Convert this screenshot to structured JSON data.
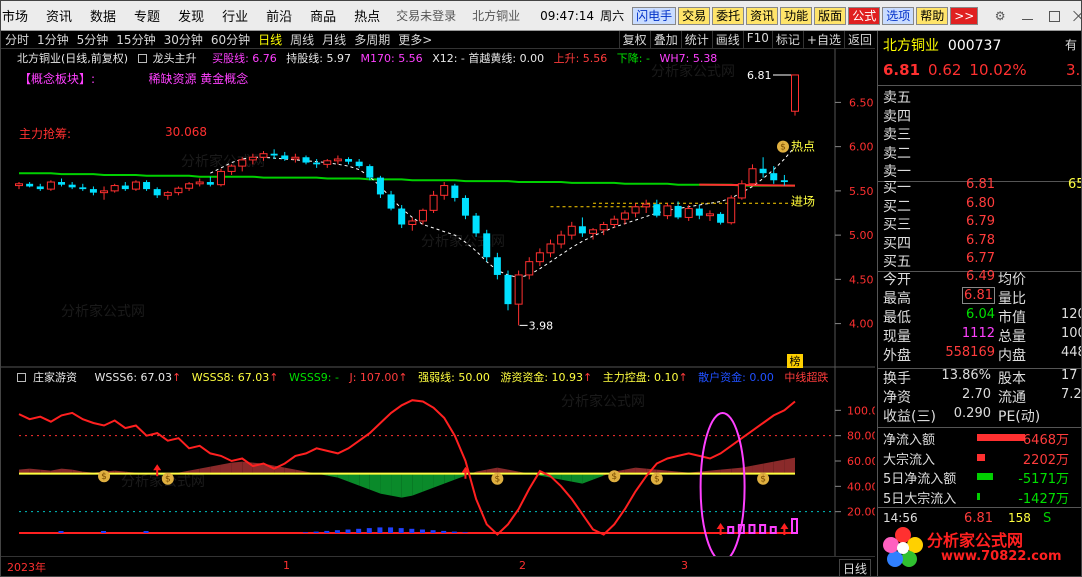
{
  "menu": {
    "items": [
      "市场",
      "资讯",
      "数据",
      "专题",
      "发现",
      "行业",
      "前沿",
      "商品",
      "热点"
    ],
    "login_status": "交易未登录",
    "stock_short": "北方铜业",
    "clock": "09:47:14",
    "weekday": "周六",
    "tools": [
      {
        "label": "闪电手",
        "style": "blue"
      },
      {
        "label": "交易",
        "style": "yellow"
      },
      {
        "label": "委托",
        "style": "yellow"
      },
      {
        "label": "资讯",
        "style": "yellow"
      },
      {
        "label": "功能",
        "style": "yellow"
      },
      {
        "label": "版面",
        "style": "yellow"
      },
      {
        "label": "公式",
        "style": "red"
      },
      {
        "label": "选项",
        "style": "blue"
      },
      {
        "label": "帮助",
        "style": "yellow"
      }
    ],
    "next_label": ">>"
  },
  "periods": {
    "items": [
      "分时",
      "1分钟",
      "5分钟",
      "15分钟",
      "30分钟",
      "60分钟",
      "日线",
      "周线",
      "月线",
      "多周期",
      "更多"
    ],
    "active": "日线",
    "more_arrow": ">"
  },
  "right_tools": [
    "复权",
    "叠加",
    "统计",
    "画线",
    "F10",
    "标记",
    "+自选",
    "返回"
  ],
  "main_header": {
    "stock": "北方铜业(日线,前复权)",
    "strategy": "龙头主升",
    "buy_line": "买股线: 6.76",
    "hold_line": "持股线: 5.97",
    "m170": "M170: 5.56",
    "x12": "X12: - 首越黄线: 0.00",
    "up": "上升: 5.56",
    "down": "下降: -",
    "wh7": "WH7: 5.38"
  },
  "concept": {
    "label": "【概念板块】:",
    "value": "稀缺资源 黄金概念"
  },
  "main_force": {
    "label": "主力抢筹:",
    "value": "30.068"
  },
  "annotations": {
    "high": "6.81",
    "low": "3.98",
    "hot": "热点",
    "entry": "进场",
    "rank": "榜"
  },
  "icons": {
    "money_bag": "money-bag-icon",
    "up_arrow": "up-arrow-icon"
  },
  "colors": {
    "up": "#ff3030",
    "down": "#00e0ff",
    "ma": "#00d000",
    "bg": "#000000"
  },
  "sub_header": {
    "name": "庄家游资",
    "wsss6": "WSSS6: 67.03",
    "wsss8": "WSSS8: 67.03",
    "wsss9": "WSSS9: -",
    "j": "J: 107.00",
    "strength": "强弱线: 50.00",
    "hot_money": "游资资金: 10.93",
    "control": "主力控盘: 0.10",
    "retail": "散户资金: 0.00",
    "super": "中线超跌"
  },
  "date_axis": {
    "labels": [
      "2023年",
      "1",
      "2",
      "3"
    ],
    "period_btn": "日线"
  },
  "chart_data": [
    {
      "type": "candlestick",
      "title": "北方铜业(日线,前复权)",
      "ylim": [
        3.6,
        6.9
      ],
      "yticks": [
        4.0,
        4.5,
        5.0,
        5.5,
        6.0,
        6.5
      ],
      "ohlc": [
        [
          5.56,
          5.6,
          5.52,
          5.58
        ],
        [
          5.58,
          5.6,
          5.54,
          5.55
        ],
        [
          5.55,
          5.58,
          5.5,
          5.52
        ],
        [
          5.52,
          5.62,
          5.5,
          5.6
        ],
        [
          5.6,
          5.64,
          5.55,
          5.57
        ],
        [
          5.57,
          5.6,
          5.52,
          5.54
        ],
        [
          5.54,
          5.58,
          5.5,
          5.52
        ],
        [
          5.52,
          5.55,
          5.45,
          5.48
        ],
        [
          5.48,
          5.55,
          5.4,
          5.5
        ],
        [
          5.5,
          5.58,
          5.48,
          5.56
        ],
        [
          5.56,
          5.6,
          5.5,
          5.52
        ],
        [
          5.52,
          5.62,
          5.5,
          5.6
        ],
        [
          5.6,
          5.62,
          5.5,
          5.52
        ],
        [
          5.52,
          5.54,
          5.42,
          5.45
        ],
        [
          5.45,
          5.5,
          5.4,
          5.48
        ],
        [
          5.48,
          5.55,
          5.45,
          5.53
        ],
        [
          5.53,
          5.6,
          5.5,
          5.58
        ],
        [
          5.58,
          5.64,
          5.55,
          5.6
        ],
        [
          5.6,
          5.66,
          5.55,
          5.57
        ],
        [
          5.57,
          5.75,
          5.55,
          5.72
        ],
        [
          5.72,
          5.8,
          5.68,
          5.78
        ],
        [
          5.78,
          5.88,
          5.72,
          5.85
        ],
        [
          5.85,
          5.92,
          5.8,
          5.88
        ],
        [
          5.88,
          5.95,
          5.84,
          5.92
        ],
        [
          5.92,
          5.97,
          5.86,
          5.9
        ],
        [
          5.9,
          5.94,
          5.84,
          5.86
        ],
        [
          5.86,
          5.92,
          5.82,
          5.88
        ],
        [
          5.88,
          5.9,
          5.8,
          5.82
        ],
        [
          5.82,
          5.86,
          5.76,
          5.8
        ],
        [
          5.8,
          5.86,
          5.76,
          5.84
        ],
        [
          5.84,
          5.9,
          5.8,
          5.86
        ],
        [
          5.86,
          5.88,
          5.8,
          5.83
        ],
        [
          5.83,
          5.86,
          5.76,
          5.78
        ],
        [
          5.78,
          5.8,
          5.62,
          5.65
        ],
        [
          5.65,
          5.67,
          5.42,
          5.46
        ],
        [
          5.46,
          5.5,
          5.28,
          5.3
        ],
        [
          5.3,
          5.34,
          5.08,
          5.12
        ],
        [
          5.12,
          5.2,
          5.05,
          5.16
        ],
        [
          5.16,
          5.3,
          5.12,
          5.28
        ],
        [
          5.28,
          5.5,
          5.25,
          5.45
        ],
        [
          5.45,
          5.6,
          5.4,
          5.56
        ],
        [
          5.56,
          5.58,
          5.38,
          5.42
        ],
        [
          5.42,
          5.45,
          5.18,
          5.22
        ],
        [
          5.22,
          5.25,
          4.98,
          5.02
        ],
        [
          5.02,
          5.06,
          4.7,
          4.75
        ],
        [
          4.75,
          4.8,
          4.5,
          4.55
        ],
        [
          4.55,
          4.6,
          4.15,
          4.22
        ],
        [
          4.22,
          4.6,
          3.98,
          4.55
        ],
        [
          4.55,
          4.75,
          4.5,
          4.7
        ],
        [
          4.7,
          4.85,
          4.65,
          4.8
        ],
        [
          4.8,
          4.95,
          4.75,
          4.9
        ],
        [
          4.9,
          5.05,
          4.85,
          5.0
        ],
        [
          5.0,
          5.15,
          4.95,
          5.1
        ],
        [
          5.1,
          5.2,
          4.98,
          5.02
        ],
        [
          5.02,
          5.08,
          4.95,
          5.06
        ],
        [
          5.06,
          5.15,
          5.0,
          5.12
        ],
        [
          5.12,
          5.22,
          5.08,
          5.18
        ],
        [
          5.18,
          5.28,
          5.12,
          5.25
        ],
        [
          5.25,
          5.36,
          5.2,
          5.32
        ],
        [
          5.32,
          5.4,
          5.25,
          5.35
        ],
        [
          5.35,
          5.4,
          5.2,
          5.22
        ],
        [
          5.22,
          5.36,
          5.18,
          5.33
        ],
        [
          5.33,
          5.38,
          5.18,
          5.2
        ],
        [
          5.2,
          5.34,
          5.16,
          5.3
        ],
        [
          5.3,
          5.34,
          5.18,
          5.22
        ],
        [
          5.22,
          5.28,
          5.16,
          5.24
        ],
        [
          5.24,
          5.26,
          5.12,
          5.14
        ],
        [
          5.14,
          5.45,
          5.12,
          5.42
        ],
        [
          5.42,
          5.62,
          5.4,
          5.58
        ],
        [
          5.58,
          5.8,
          5.55,
          5.75
        ],
        [
          5.75,
          5.88,
          5.65,
          5.7
        ],
        [
          5.7,
          5.78,
          5.58,
          5.62
        ],
        [
          5.62,
          5.68,
          5.56,
          5.6
        ],
        [
          6.4,
          6.81,
          6.35,
          6.81
        ]
      ],
      "ma_green": [
        5.7,
        5.7,
        5.7,
        5.7,
        5.69,
        5.69,
        5.69,
        5.69,
        5.68,
        5.68,
        5.68,
        5.68,
        5.67,
        5.67,
        5.67,
        5.67,
        5.67,
        5.66,
        5.66,
        5.66,
        5.66,
        5.66,
        5.66,
        5.65,
        5.65,
        5.65,
        5.65,
        5.65,
        5.65,
        5.64,
        5.64,
        5.64,
        5.64,
        5.63,
        5.63,
        5.63,
        5.63,
        5.62,
        5.62,
        5.62,
        5.62,
        5.62,
        5.61,
        5.61,
        5.61,
        5.61,
        5.61,
        5.6,
        5.6,
        5.6,
        5.6,
        5.6,
        5.59,
        5.59,
        5.59,
        5.59,
        5.59,
        5.58,
        5.58,
        5.58,
        5.58,
        5.58,
        5.57,
        5.57,
        5.57,
        5.57,
        5.57,
        5.57,
        5.56,
        5.56,
        5.56,
        5.56,
        5.56,
        5.56
      ],
      "dashed_trend": [
        null,
        null,
        null,
        null,
        null,
        null,
        null,
        null,
        null,
        null,
        null,
        null,
        null,
        null,
        null,
        null,
        null,
        null,
        5.7,
        5.76,
        5.82,
        5.86,
        5.88,
        5.88,
        5.87,
        5.86,
        5.85,
        5.84,
        5.83,
        5.82,
        5.8,
        5.78,
        5.74,
        5.66,
        5.55,
        5.42,
        5.3,
        5.2,
        5.12,
        5.08,
        5.04,
        5.0,
        4.92,
        4.82,
        4.7,
        4.6,
        4.55,
        4.52,
        4.55,
        4.62,
        4.7,
        4.78,
        4.86,
        4.93,
        4.99,
        5.04,
        5.09,
        5.13,
        5.17,
        5.21,
        5.25,
        5.28,
        5.3,
        5.32,
        5.34,
        5.36,
        5.38,
        5.42,
        5.48,
        5.55,
        5.64,
        5.74,
        5.86,
        6.0
      ]
    },
    {
      "type": "line",
      "title": "庄家游资",
      "ylim": [
        0,
        120
      ],
      "yticks": [
        20.0,
        40.0,
        60.0,
        80.0,
        100.0
      ],
      "series": [
        {
          "name": "WSSS6",
          "values": [
            97,
            93,
            95,
            91,
            96,
            98,
            93,
            90,
            88,
            92,
            86,
            88,
            80,
            82,
            76,
            78,
            70,
            72,
            66,
            64,
            60,
            62,
            56,
            58,
            54,
            58,
            64,
            66,
            70,
            68,
            66,
            70,
            76,
            82,
            90,
            98,
            104,
            108,
            107,
            102,
            94,
            80,
            60,
            30,
            10,
            2,
            10,
            22,
            38,
            52,
            48,
            40,
            30,
            18,
            6,
            2,
            10,
            22,
            36,
            48,
            58,
            62,
            64,
            66,
            64,
            62,
            66,
            72,
            78,
            84,
            90,
            96,
            100,
            107
          ]
        },
        {
          "name": "J",
          "values": [
            97,
            93,
            95,
            91,
            96,
            98,
            93,
            90,
            88,
            92,
            86,
            88,
            80,
            82,
            76,
            78,
            70,
            72,
            66,
            64,
            60,
            62,
            56,
            58,
            54,
            58,
            64,
            66,
            70,
            68,
            66,
            70,
            76,
            82,
            90,
            98,
            104,
            108,
            107,
            102,
            94,
            80,
            60,
            30,
            10,
            2,
            10,
            22,
            38,
            52,
            48,
            40,
            30,
            18,
            6,
            2,
            10,
            22,
            36,
            48,
            58,
            62,
            64,
            66,
            64,
            62,
            66,
            72,
            78,
            84,
            90,
            96,
            100,
            107
          ]
        }
      ]
    }
  ],
  "quote": {
    "name": "北方铜业",
    "code": "000737",
    "tab": "有",
    "price": "6.81",
    "change": "0.62",
    "pct": "10.02%",
    "edge_value": "3.5",
    "sells": [
      "卖五",
      "卖四",
      "卖三",
      "卖二",
      "卖一"
    ],
    "buys": [
      {
        "label": "买一",
        "price": "6.81",
        "vol": "65"
      },
      {
        "label": "买二",
        "price": "6.80",
        "vol": ""
      },
      {
        "label": "买三",
        "price": "6.79",
        "vol": ""
      },
      {
        "label": "买四",
        "price": "6.78",
        "vol": ""
      },
      {
        "label": "买五",
        "price": "6.77",
        "vol": ""
      }
    ],
    "stats": [
      {
        "l": "今开",
        "v": "6.49",
        "cls": "c-r",
        "l2": "均价",
        "v2": ""
      },
      {
        "l": "最高",
        "v": "6.81",
        "cls": "c-r boxv",
        "l2": "量比",
        "v2": ""
      },
      {
        "l": "最低",
        "v": "6.04",
        "cls": "c-g",
        "l2": "市值",
        "v2": "120"
      },
      {
        "l": "现量",
        "v": "1112",
        "cls": "c-m",
        "l2": "总量",
        "v2": "100"
      },
      {
        "l": "外盘",
        "v": "558169",
        "cls": "c-r",
        "l2": "内盘",
        "v2": "448"
      }
    ],
    "stats2": [
      {
        "l": "换手",
        "v": "13.86%",
        "l2": "股本",
        "v2": "17"
      },
      {
        "l": "净资",
        "v": "2.70",
        "l2": "流通",
        "v2": "7.2"
      },
      {
        "l": "收益(三)",
        "v": "0.290",
        "l2": "PE(动)",
        "v2": ""
      }
    ],
    "flows": [
      {
        "l": "净流入额",
        "v": "6468万",
        "cls": "c-r",
        "bar": 48,
        "barcolor": "#ff3030"
      },
      {
        "l": "大宗流入",
        "v": "2202万",
        "cls": "c-r",
        "bar": 8,
        "barcolor": "#ff3030"
      },
      {
        "l": "5日净流入额",
        "v": "-5171万",
        "cls": "c-g",
        "bar": 16,
        "barcolor": "#00d000"
      },
      {
        "l": "5日大宗流入",
        "v": "-1427万",
        "cls": "c-g",
        "bar": 3,
        "barcolor": "#00d000"
      }
    ],
    "tick": {
      "time": "14:56",
      "price": "6.81",
      "vol": "158",
      "flag": "S"
    }
  },
  "watermark": "分析家公式网",
  "logo": {
    "text": "分析家公式网",
    "url": "www.70822.com"
  }
}
